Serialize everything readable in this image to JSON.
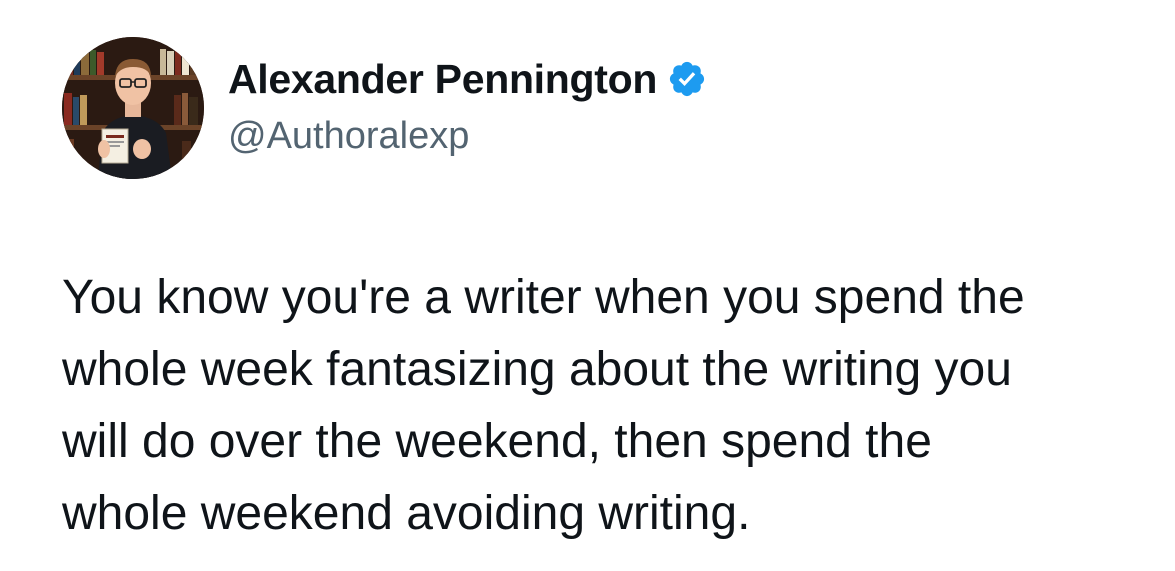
{
  "author": {
    "display_name": "Alexander Pennington",
    "handle": "@Authoralexp",
    "verified": true,
    "verified_icon": "verified-badge-icon",
    "verified_color": "#1d9bf0"
  },
  "tweet": {
    "lines": [
      "You know you're a writer when you spend the",
      "whole week fantasizing about the writing you",
      "will do over the weekend, then spend the",
      "whole weekend avoiding writing."
    ]
  },
  "colors": {
    "text": "#0f1419",
    "secondary": "#536471",
    "background": "#ffffff"
  }
}
